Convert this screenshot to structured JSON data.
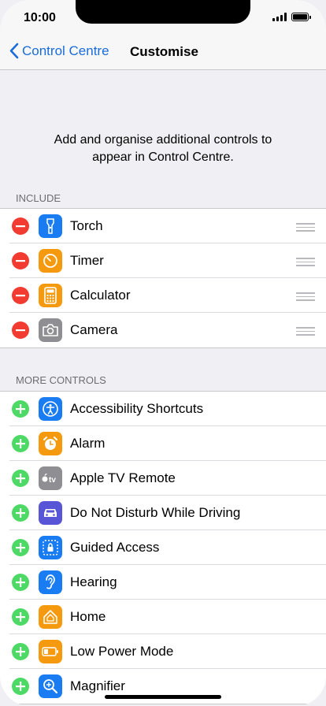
{
  "status_bar": {
    "time": "10:00"
  },
  "nav": {
    "back_label": "Control Centre",
    "title": "Customise"
  },
  "description": "Add and organise additional controls to appear in Control Centre.",
  "include_header": "INCLUDE",
  "more_header": "MORE CONTROLS",
  "include_items": [
    {
      "label": "Torch",
      "icon": "torch-icon",
      "color": "#1a7cf2"
    },
    {
      "label": "Timer",
      "icon": "timer-icon",
      "color": "#f59a0e"
    },
    {
      "label": "Calculator",
      "icon": "calculator-icon",
      "color": "#f59a0e"
    },
    {
      "label": "Camera",
      "icon": "camera-icon",
      "color": "#8e8e93"
    }
  ],
  "more_items": [
    {
      "label": "Accessibility Shortcuts",
      "icon": "accessibility-icon",
      "color": "#1a7cf2"
    },
    {
      "label": "Alarm",
      "icon": "alarm-icon",
      "color": "#f59a0e"
    },
    {
      "label": "Apple TV Remote",
      "icon": "apple-tv-icon",
      "color": "#8e8e93"
    },
    {
      "label": "Do Not Disturb While Driving",
      "icon": "car-icon",
      "color": "#5856d6"
    },
    {
      "label": "Guided Access",
      "icon": "guided-access-icon",
      "color": "#1a7cf2"
    },
    {
      "label": "Hearing",
      "icon": "ear-icon",
      "color": "#1a7cf2"
    },
    {
      "label": "Home",
      "icon": "home-icon",
      "color": "#f59a0e"
    },
    {
      "label": "Low Power Mode",
      "icon": "battery-icon",
      "color": "#f59a0e"
    },
    {
      "label": "Magnifier",
      "icon": "magnifier-icon",
      "color": "#1a7cf2"
    }
  ]
}
